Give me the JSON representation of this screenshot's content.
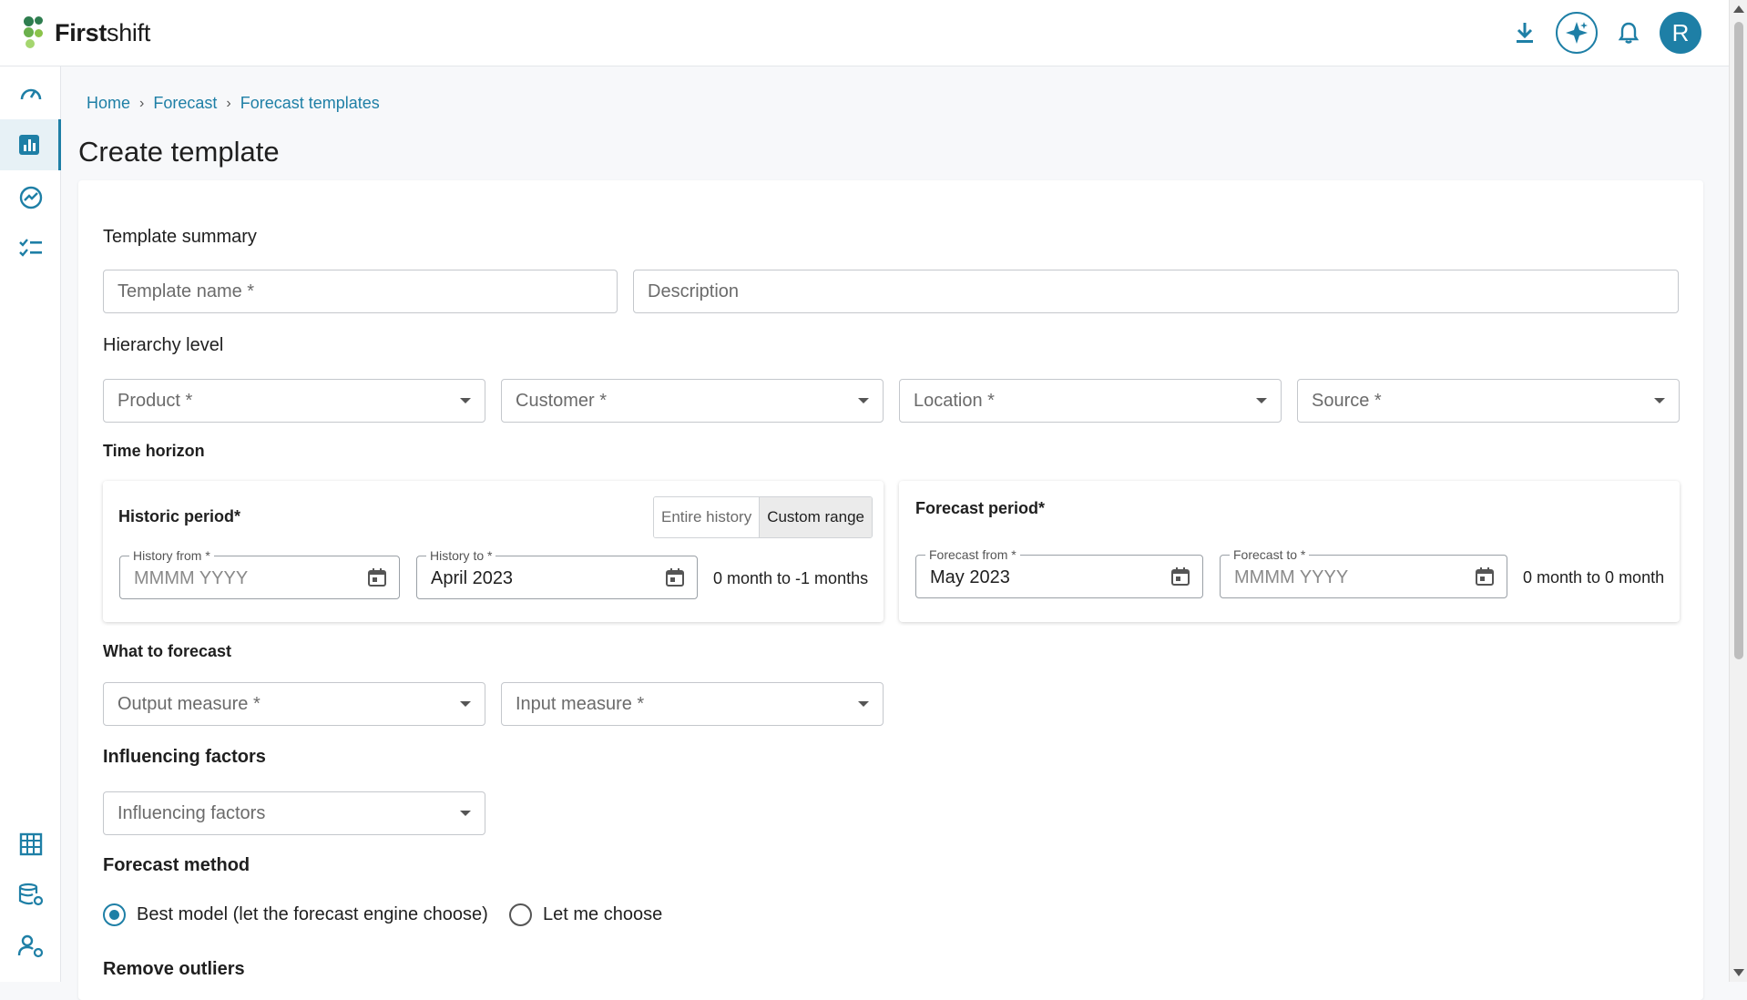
{
  "app": {
    "brand_bold": "First",
    "brand_light": "shift",
    "avatar_initial": "R"
  },
  "topbar": {
    "icons": [
      "download-icon",
      "ai-sparkle-icon",
      "bell-icon",
      "avatar"
    ]
  },
  "rail": {
    "items": [
      "dashboard-icon",
      "bar-chart-icon",
      "trend-icon",
      "checklist-icon",
      "building-icon",
      "database-settings-icon",
      "user-settings-icon"
    ],
    "active": "bar-chart-icon"
  },
  "breadcrumb": {
    "home": "Home",
    "forecast": "Forecast",
    "templates": "Forecast templates",
    "sep": "›"
  },
  "page": {
    "title": "Create template"
  },
  "summary": {
    "label": "Template summary",
    "name_placeholder": "Template name *",
    "description_placeholder": "Description"
  },
  "hierarchy": {
    "label": "Hierarchy level",
    "product": "Product *",
    "customer": "Customer *",
    "location": "Location *",
    "source": "Source *"
  },
  "time_horizon": {
    "label": "Time horizon",
    "historic": {
      "title": "Historic period*",
      "toggle_entire": "Entire history",
      "toggle_custom": "Custom range",
      "from_label": "History from *",
      "from_value": "MMMM YYYY",
      "to_label": "History to *",
      "to_value": "April 2023",
      "range_text": "0 month to -1 months"
    },
    "forecast": {
      "title": "Forecast period*",
      "from_label": "Forecast from *",
      "from_value": "May 2023",
      "to_label": "Forecast to *",
      "to_value": "MMMM YYYY",
      "range_text": "0 month to 0 month"
    }
  },
  "what_to_forecast": {
    "label": "What to forecast",
    "output_placeholder": "Output measure *",
    "input_placeholder": "Input measure *"
  },
  "influencing": {
    "label": "Influencing factors",
    "placeholder": "Influencing factors"
  },
  "forecast_method": {
    "label": "Forecast method",
    "option_best": "Best model (let the forecast engine choose)",
    "option_choose": "Let me choose",
    "selected": "best"
  },
  "remove_outliers": {
    "label": "Remove outliers"
  },
  "colors": {
    "accent": "#1e7fa6"
  }
}
